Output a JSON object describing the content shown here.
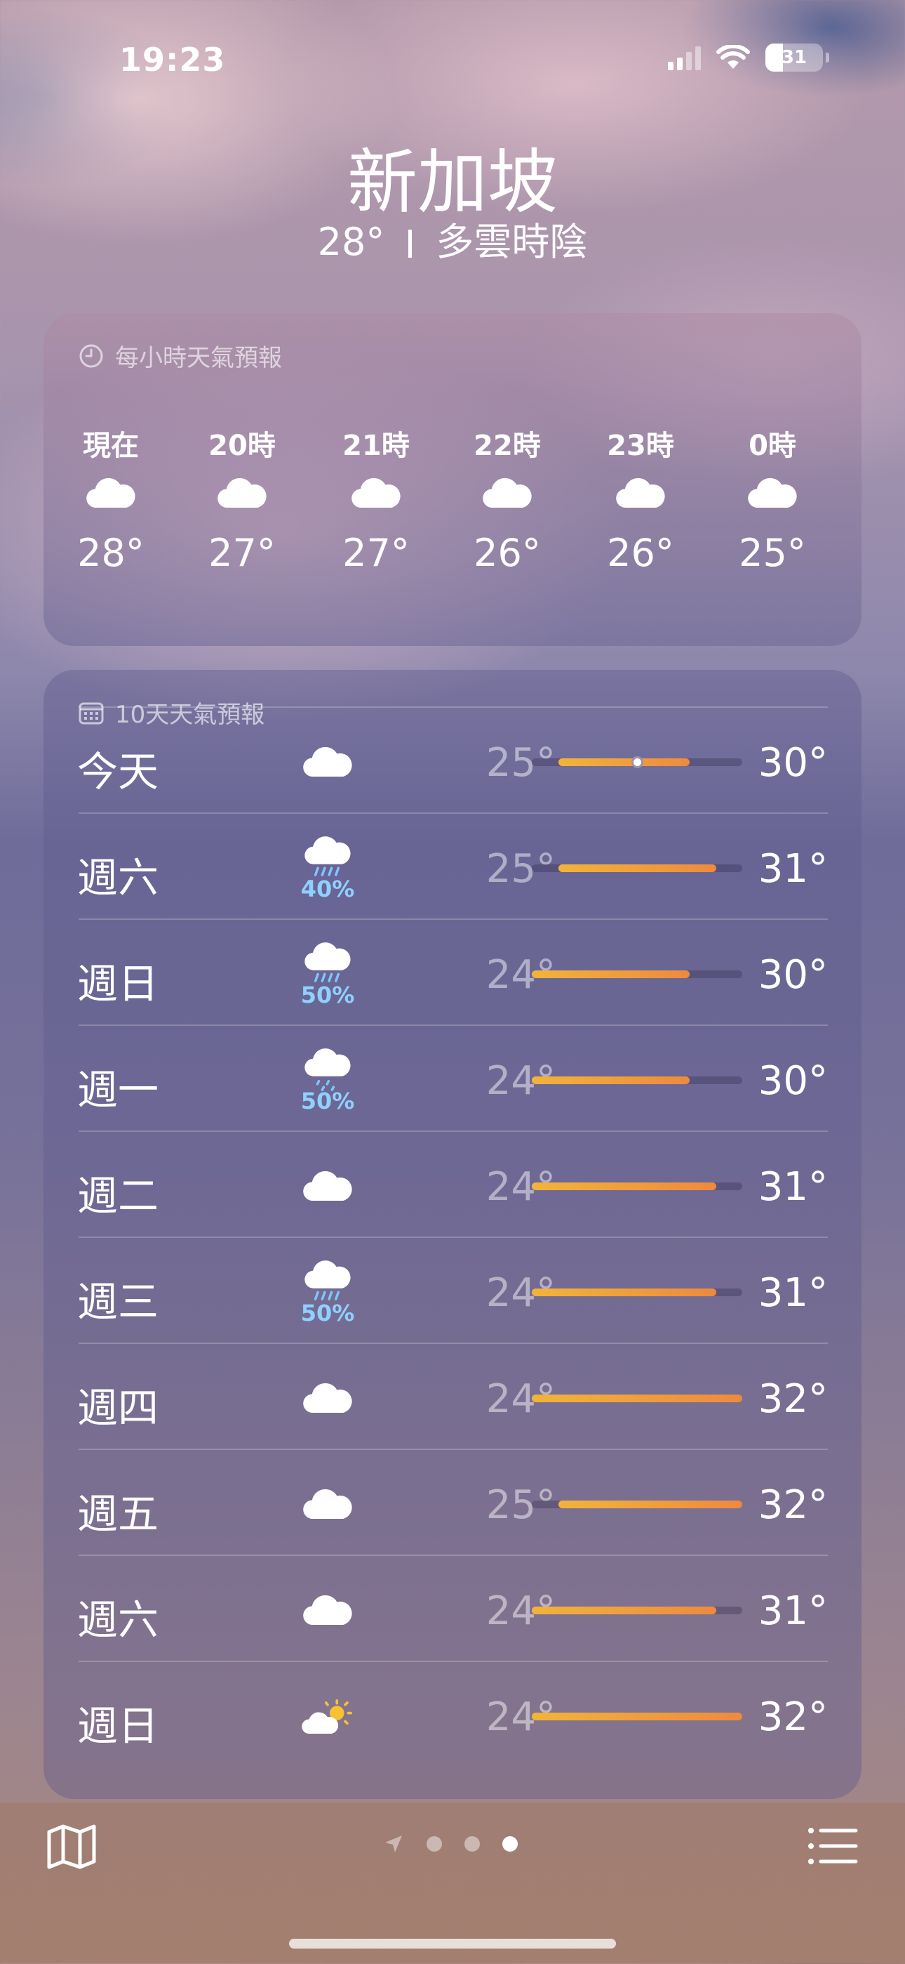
{
  "status_bar": {
    "time": "19:23",
    "battery": "31"
  },
  "location": {
    "city": "新加坡",
    "current_temp": "28°",
    "condition": "多雲時陰"
  },
  "hourly": {
    "title": "每小時天氣預報",
    "items": [
      {
        "label": "現在",
        "icon": "cloud-icon",
        "temp": "28°"
      },
      {
        "label": "20時",
        "icon": "cloud-icon",
        "temp": "27°"
      },
      {
        "label": "21時",
        "icon": "cloud-icon",
        "temp": "27°"
      },
      {
        "label": "22時",
        "icon": "cloud-icon",
        "temp": "26°"
      },
      {
        "label": "23時",
        "icon": "cloud-icon",
        "temp": "26°"
      },
      {
        "label": "0時",
        "icon": "cloud-icon",
        "temp": "25°"
      }
    ]
  },
  "daily": {
    "title": "10天天氣預報",
    "range_min": 24,
    "range_max": 32,
    "current_temp_value": 28,
    "days": [
      {
        "name": "今天",
        "icon": "cloud-icon",
        "pop": "",
        "low": "25°",
        "high": "30°",
        "low_value": 25,
        "high_value": 30,
        "is_today": true
      },
      {
        "name": "週六",
        "icon": "cloud-rain-icon",
        "pop": "40%",
        "low": "25°",
        "high": "31°",
        "low_value": 25,
        "high_value": 31
      },
      {
        "name": "週日",
        "icon": "cloud-rain-icon",
        "pop": "50%",
        "low": "24°",
        "high": "30°",
        "low_value": 24,
        "high_value": 30
      },
      {
        "name": "週一",
        "icon": "cloud-drizzle-icon",
        "pop": "50%",
        "low": "24°",
        "high": "30°",
        "low_value": 24,
        "high_value": 30
      },
      {
        "name": "週二",
        "icon": "cloud-icon",
        "pop": "",
        "low": "24°",
        "high": "31°",
        "low_value": 24,
        "high_value": 31
      },
      {
        "name": "週三",
        "icon": "cloud-rain-icon",
        "pop": "50%",
        "low": "24°",
        "high": "31°",
        "low_value": 24,
        "high_value": 31
      },
      {
        "name": "週四",
        "icon": "cloud-icon",
        "pop": "",
        "low": "24°",
        "high": "32°",
        "low_value": 24,
        "high_value": 32
      },
      {
        "name": "週五",
        "icon": "cloud-icon",
        "pop": "",
        "low": "25°",
        "high": "32°",
        "low_value": 25,
        "high_value": 32
      },
      {
        "name": "週六",
        "icon": "cloud-icon",
        "pop": "",
        "low": "24°",
        "high": "31°",
        "low_value": 24,
        "high_value": 31
      },
      {
        "name": "週日",
        "icon": "cloud-sun-icon",
        "pop": "",
        "low": "24°",
        "high": "32°",
        "low_value": 24,
        "high_value": 32
      }
    ]
  },
  "toolbar": {
    "map_icon": "map-icon",
    "list_icon": "list-icon",
    "location_icon": "location-arrow-icon",
    "page_count": 3,
    "active_page": 3
  }
}
